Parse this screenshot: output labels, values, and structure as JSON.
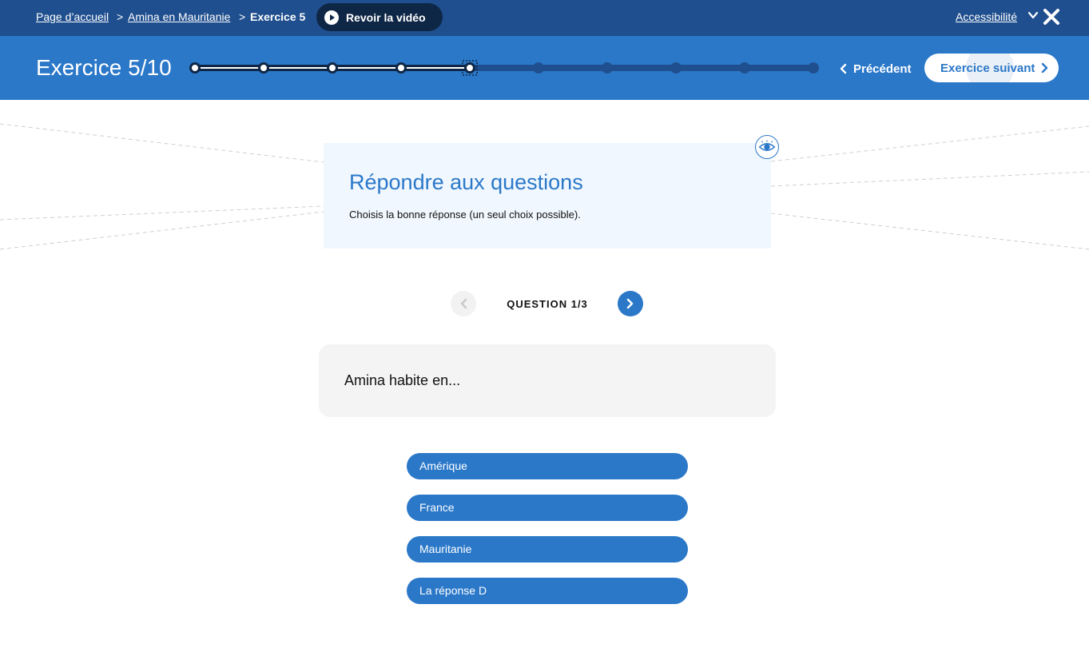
{
  "breadcrumb": {
    "home": "Page d’accueil",
    "separator": ">",
    "lesson": "Amina en Mauritanie",
    "current": "Exercice 5"
  },
  "video_button": {
    "label": "Revoir la vidéo",
    "icon": "play-icon"
  },
  "accessibility": {
    "label": "Accessibilité",
    "icon": "chevron-down-icon"
  },
  "close": {
    "icon": "close-icon"
  },
  "header": {
    "title": "Exercice 5/10",
    "progress": {
      "current": 5,
      "total": 10
    },
    "prev_label": "Précédent",
    "next_label": "Exercice suivant"
  },
  "instructions": {
    "title": "Répondre aux questions",
    "subtitle": "Choisis la bonne réponse (un seul choix possible).",
    "icon": "eye-icon"
  },
  "question_nav": {
    "label": "QUESTION 1/3"
  },
  "question": {
    "text": "Amina habite en..."
  },
  "answers": [
    {
      "label": "Amérique"
    },
    {
      "label": "France"
    },
    {
      "label": "Mauritanie"
    },
    {
      "label": "La réponse D"
    }
  ],
  "colors": {
    "topbar": "#1f4f8e",
    "header": "#2b78c9",
    "accent": "#2b78c9",
    "progress_done": "#0f2746",
    "card_bg": "#f0f7fe",
    "question_bg": "#f4f4f4"
  }
}
